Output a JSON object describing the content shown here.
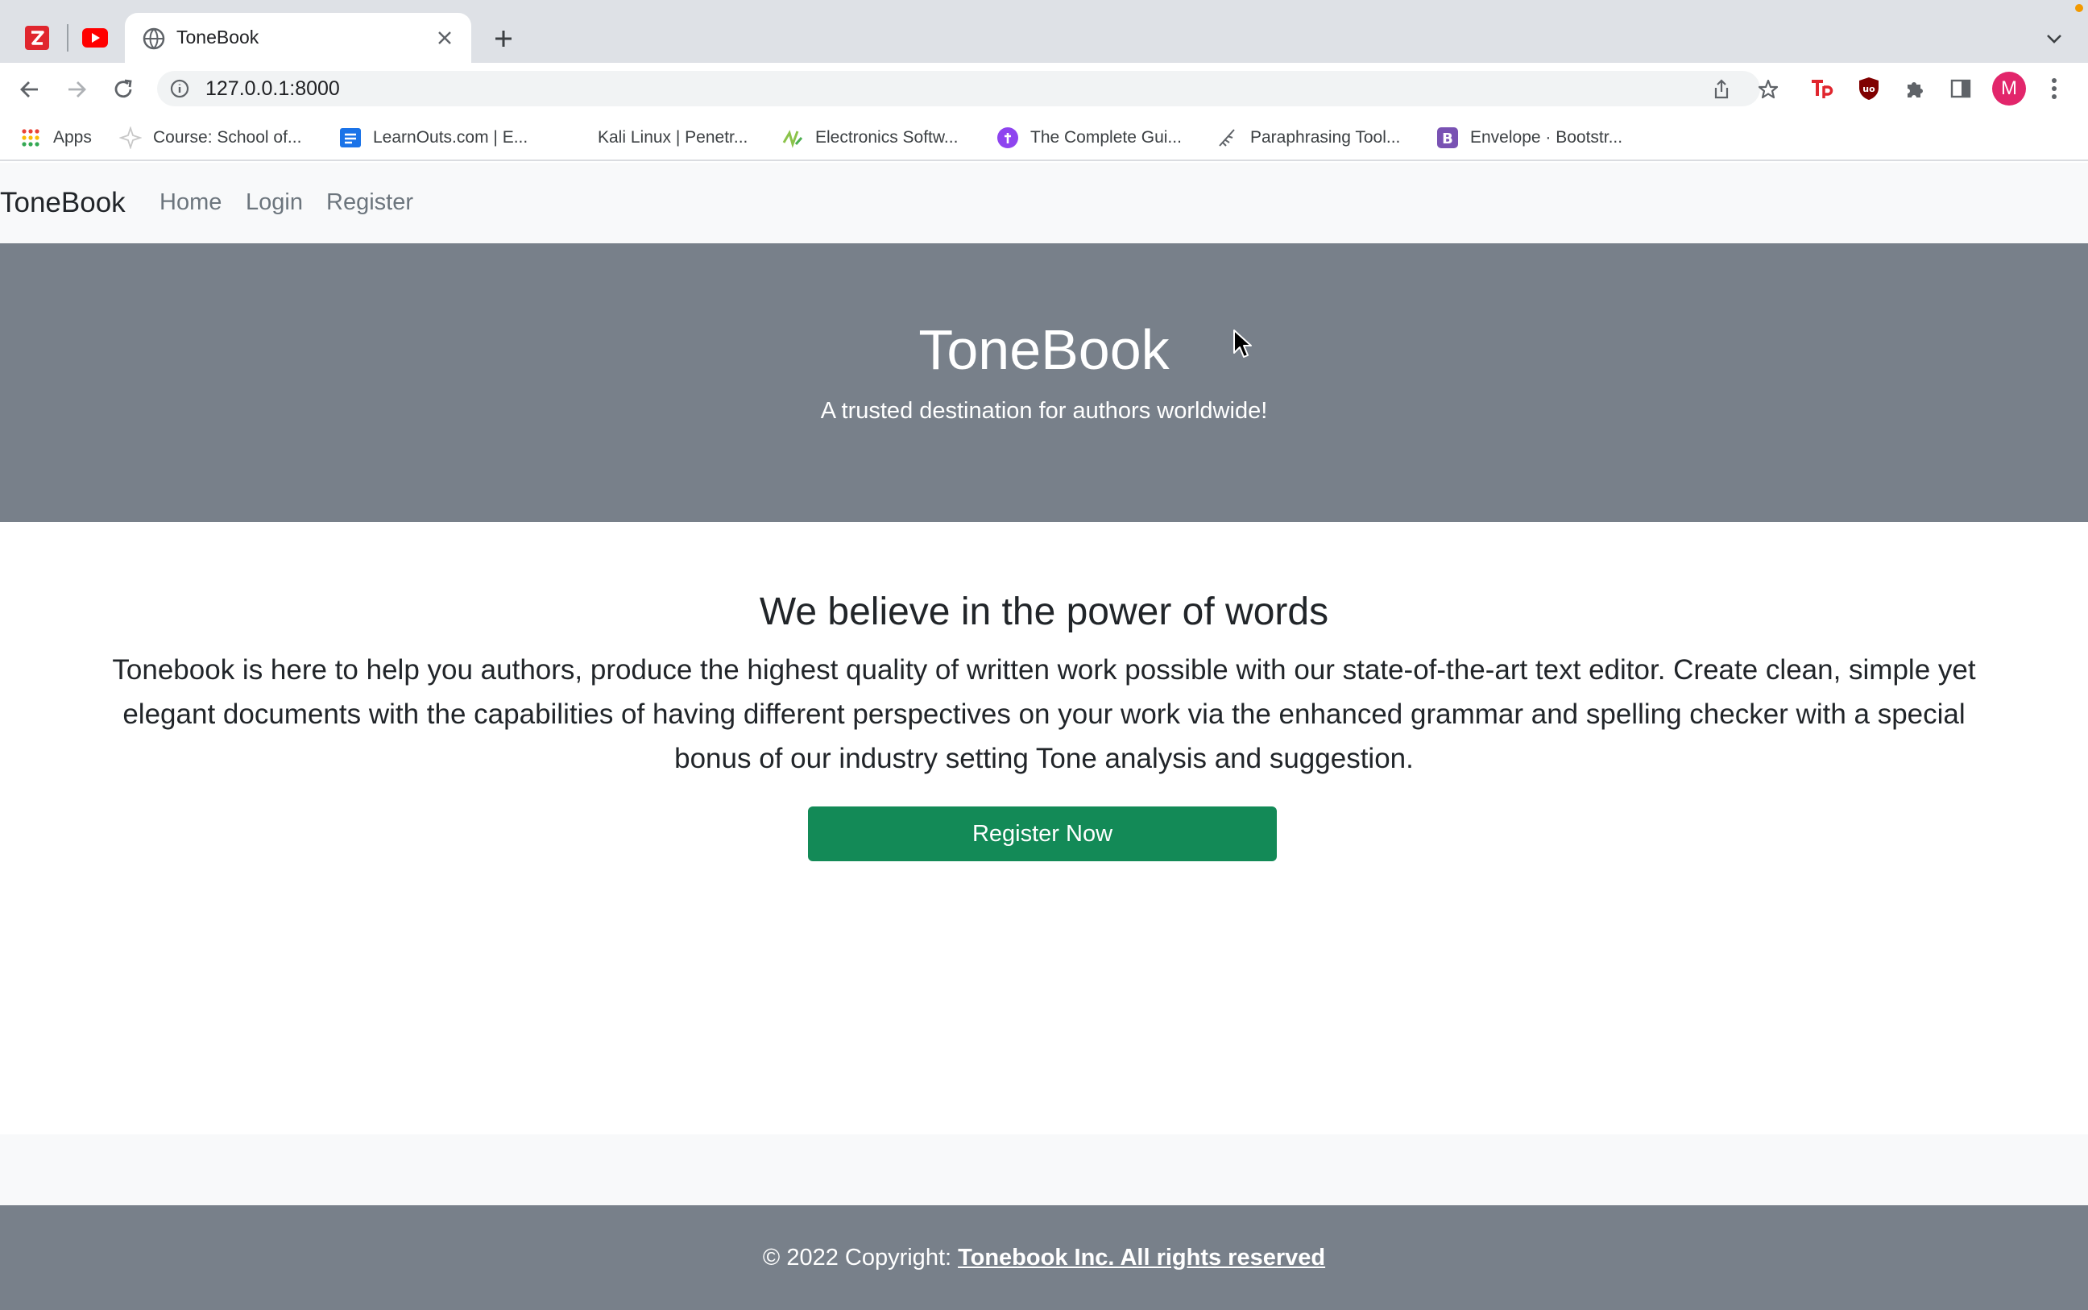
{
  "browser": {
    "pinned_tabs": [
      {
        "name": "zotero-tab",
        "icon": "zotero-icon",
        "letter": "Z",
        "color": "#e0262e"
      },
      {
        "name": "youtube-tab",
        "icon": "youtube-icon",
        "color": "#ff0000"
      }
    ],
    "active_tab": {
      "title": "ToneBook",
      "icon": "globe-icon"
    },
    "address": "127.0.0.1:8000",
    "avatar_letter": "M",
    "bookmarks": [
      {
        "label": "Apps",
        "icon": "apps-grid-icon"
      },
      {
        "label": "Course: School of...",
        "icon": "course-star-icon"
      },
      {
        "label": "LearnOuts.com | E...",
        "icon": "learnouts-icon"
      },
      {
        "label": "Kali Linux | Penetr...",
        "icon": "kali-icon"
      },
      {
        "label": "Electronics Softw...",
        "icon": "electronics-icon"
      },
      {
        "label": "The Complete Gui...",
        "icon": "guide-icon"
      },
      {
        "label": "Paraphrasing Tool...",
        "icon": "quill-icon"
      },
      {
        "label": "Envelope · Bootstr...",
        "icon": "bootstrap-icon"
      }
    ]
  },
  "navbar": {
    "brand": "ToneBook",
    "links": [
      "Home",
      "Login",
      "Register"
    ]
  },
  "hero": {
    "title": "ToneBook",
    "subtitle": "A trusted destination for authors worldwide!"
  },
  "about": {
    "heading": "We believe in the power of words",
    "text": "Tonebook is here to help you authors, produce the highest quality of written work possible with our state-of-the-art text editor. Create clean, simple yet elegant documents with the capabilities of having different perspectives on your work via the enhanced grammar and spelling checker with a special bonus of our industry setting Tone analysis and suggestion.",
    "cta": "Register Now"
  },
  "footer": {
    "prefix": "© 2022 Copyright:",
    "link": "Tonebook Inc. All rights reserved"
  },
  "colors": {
    "hero_bg": "#78808a",
    "cta_bg": "#138a57",
    "navbar_bg": "#f8f9fa"
  }
}
